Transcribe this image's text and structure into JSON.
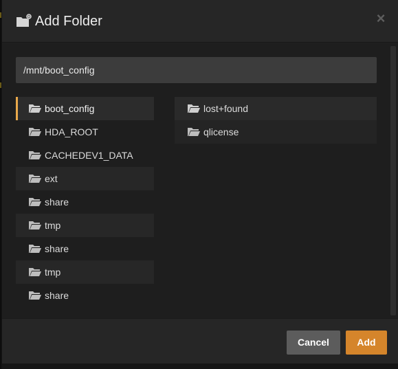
{
  "dialog": {
    "title": "Add Folder",
    "close_glyph": "×",
    "title_icon": "folder-add-icon",
    "close_icon": "close-icon"
  },
  "path_field": {
    "value": "/mnt/boot_config"
  },
  "left_column": {
    "items": [
      {
        "label": "boot_config",
        "icon": "folder-open-icon",
        "selected": true
      },
      {
        "label": "HDA_ROOT",
        "icon": "folder-open-icon"
      },
      {
        "label": "CACHEDEV1_DATA",
        "icon": "folder-open-icon"
      },
      {
        "label": "ext",
        "icon": "folder-open-icon"
      },
      {
        "label": "share",
        "icon": "folder-open-icon"
      },
      {
        "label": "tmp",
        "icon": "folder-open-icon"
      },
      {
        "label": "share",
        "icon": "folder-open-icon"
      },
      {
        "label": "tmp",
        "icon": "folder-open-icon"
      },
      {
        "label": "share",
        "icon": "folder-open-icon"
      }
    ]
  },
  "right_column": {
    "items": [
      {
        "label": "lost+found",
        "icon": "folder-open-icon"
      },
      {
        "label": "qlicense",
        "icon": "folder-open-icon"
      }
    ]
  },
  "footer": {
    "cancel_label": "Cancel",
    "add_label": "Add"
  },
  "colors": {
    "accent": "#d5852b",
    "selection_bar": "#e9a94b",
    "cancel_button": "#5c5c5c"
  }
}
